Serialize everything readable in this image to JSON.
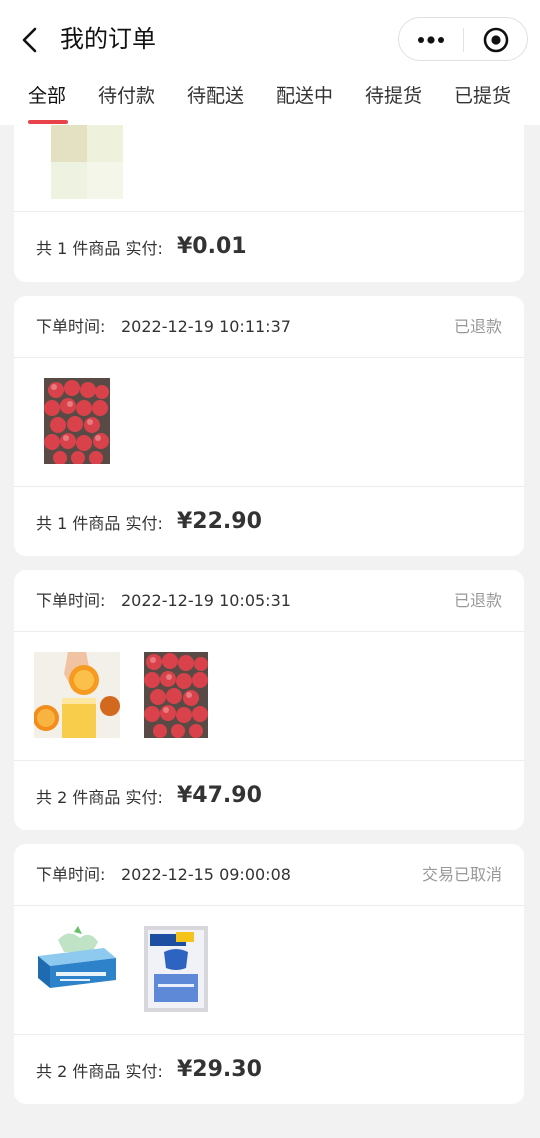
{
  "header": {
    "title": "我的订单"
  },
  "tabs": [
    {
      "label": "全部",
      "active": true
    },
    {
      "label": "待付款"
    },
    {
      "label": "待配送"
    },
    {
      "label": "配送中"
    },
    {
      "label": "待提货"
    },
    {
      "label": "已提货"
    }
  ],
  "colors": {
    "accent": "#e8424a",
    "status_gray": "#999999",
    "background": "#f2f2f2"
  },
  "orders": [
    {
      "count_text": "共 1 件商品 实付:",
      "price": "¥0.01",
      "products": [
        "blurred-product-image"
      ]
    },
    {
      "time_label": "下单时间:",
      "time": "2022-12-19 10:11:37",
      "status": "已退款",
      "count_text": "共 1 件商品 实付:",
      "price": "¥22.90",
      "products": [
        "apples-image"
      ]
    },
    {
      "time_label": "下单时间:",
      "time": "2022-12-19 10:05:31",
      "status": "已退款",
      "count_text": "共 2 件商品 实付:",
      "price": "¥47.90",
      "products": [
        "orange-juice-image",
        "apples-image"
      ]
    },
    {
      "time_label": "下单时间:",
      "time": "2022-12-15 09:00:08",
      "status": "交易已取消",
      "count_text": "共 2 件商品 实付:",
      "price": "¥29.30",
      "products": [
        "toothpaste-image",
        "soap-pack-image"
      ]
    }
  ]
}
